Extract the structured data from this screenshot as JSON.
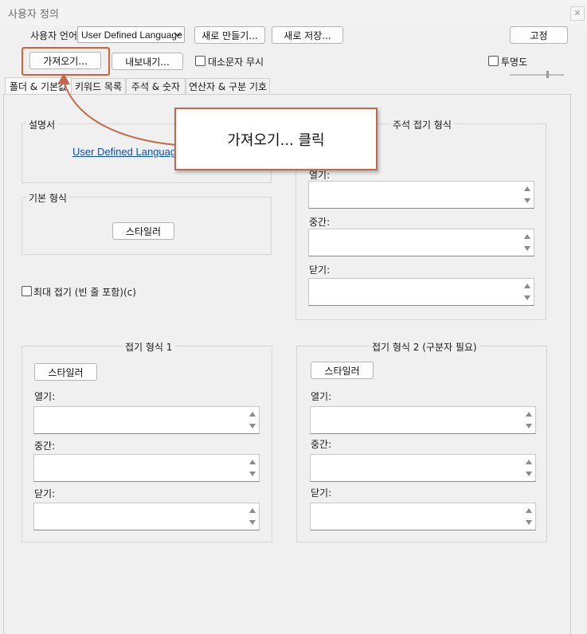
{
  "window": {
    "title": "사용자 정의",
    "close_glyph": "✕"
  },
  "toolbar": {
    "language_label": "사용자 언어",
    "language_value": "User Defined Language",
    "create_new": "새로 만들기...",
    "save_as": "새로 저장...",
    "dock": "고정",
    "import": "가져오기...",
    "export": "내보내기...",
    "ignore_case": "대소문자 무시",
    "transparency": "투명도"
  },
  "tabs": [
    "폴더 & 기본값",
    "키워드 목록",
    "주석 & 숫자",
    "연산자 & 구분 기호"
  ],
  "folder_tab": {
    "documentation": {
      "legend": "설명서",
      "link": "User Defined Languages"
    },
    "default_style": {
      "legend": "기본 형식",
      "styler": "스타일러"
    },
    "fold_compact": "최대 접기 (빈 줄 포함)(c)",
    "comment_fold": {
      "legend": "주석 접기 형식",
      "open": "열기:",
      "middle": "중간:",
      "close": "닫기:"
    },
    "fold_style_1": {
      "legend": "접기 형식 1",
      "styler": "스타일러",
      "open": "열기:",
      "middle": "중간:",
      "close": "닫기:"
    },
    "fold_style_2": {
      "legend": "접기 형식 2 (구분자 필요)",
      "styler": "스타일러",
      "open": "열기:",
      "middle": "중간:",
      "close": "닫기:"
    }
  },
  "annotation": {
    "callout": "가져오기... 클릭",
    "color": "#c3694a"
  },
  "colors": {
    "background": "#f0f0f0",
    "link": "#0b4fb5",
    "highlight": "#d0623e"
  }
}
